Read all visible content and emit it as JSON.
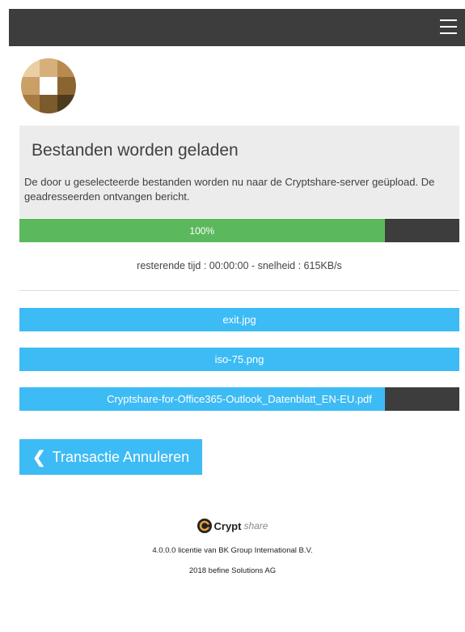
{
  "header": {
    "menu_icon": "hamburger-menu-icon",
    "bar_color": "#3d3d3d"
  },
  "logo": {
    "icon": "cryptshare-square-logo"
  },
  "upload_panel": {
    "title": "Bestanden worden geladen",
    "description": "De door u geselecteerde bestanden worden nu naar de Cryptshare-server geüpload. De geadresseerden ontvangen bericht."
  },
  "progress": {
    "label": "100%",
    "fraction": 0.83,
    "fill_color": "#5cb85c"
  },
  "status": {
    "text": "resterende tijd : 00:00:00 -  snelheid : 615KB/s"
  },
  "files": [
    {
      "name": "exit.jpg",
      "progress": 1.0
    },
    {
      "name": "iso-75.png",
      "progress": 1.0
    },
    {
      "name": "Cryptshare-for-Office365-Outlook_Datenblatt_EN-EU.pdf",
      "progress": 0.83
    }
  ],
  "actions": {
    "cancel_label": "Transactie Annuleren",
    "cancel_icon": "chevron-left-icon",
    "accent_color": "#3dbbf5"
  },
  "footer": {
    "brand_bold": "Crypt",
    "brand_italic": "share",
    "license": "4.0.0.0 licentie van BK Group International B.V.",
    "copyright": "2018 befine Solutions AG"
  }
}
